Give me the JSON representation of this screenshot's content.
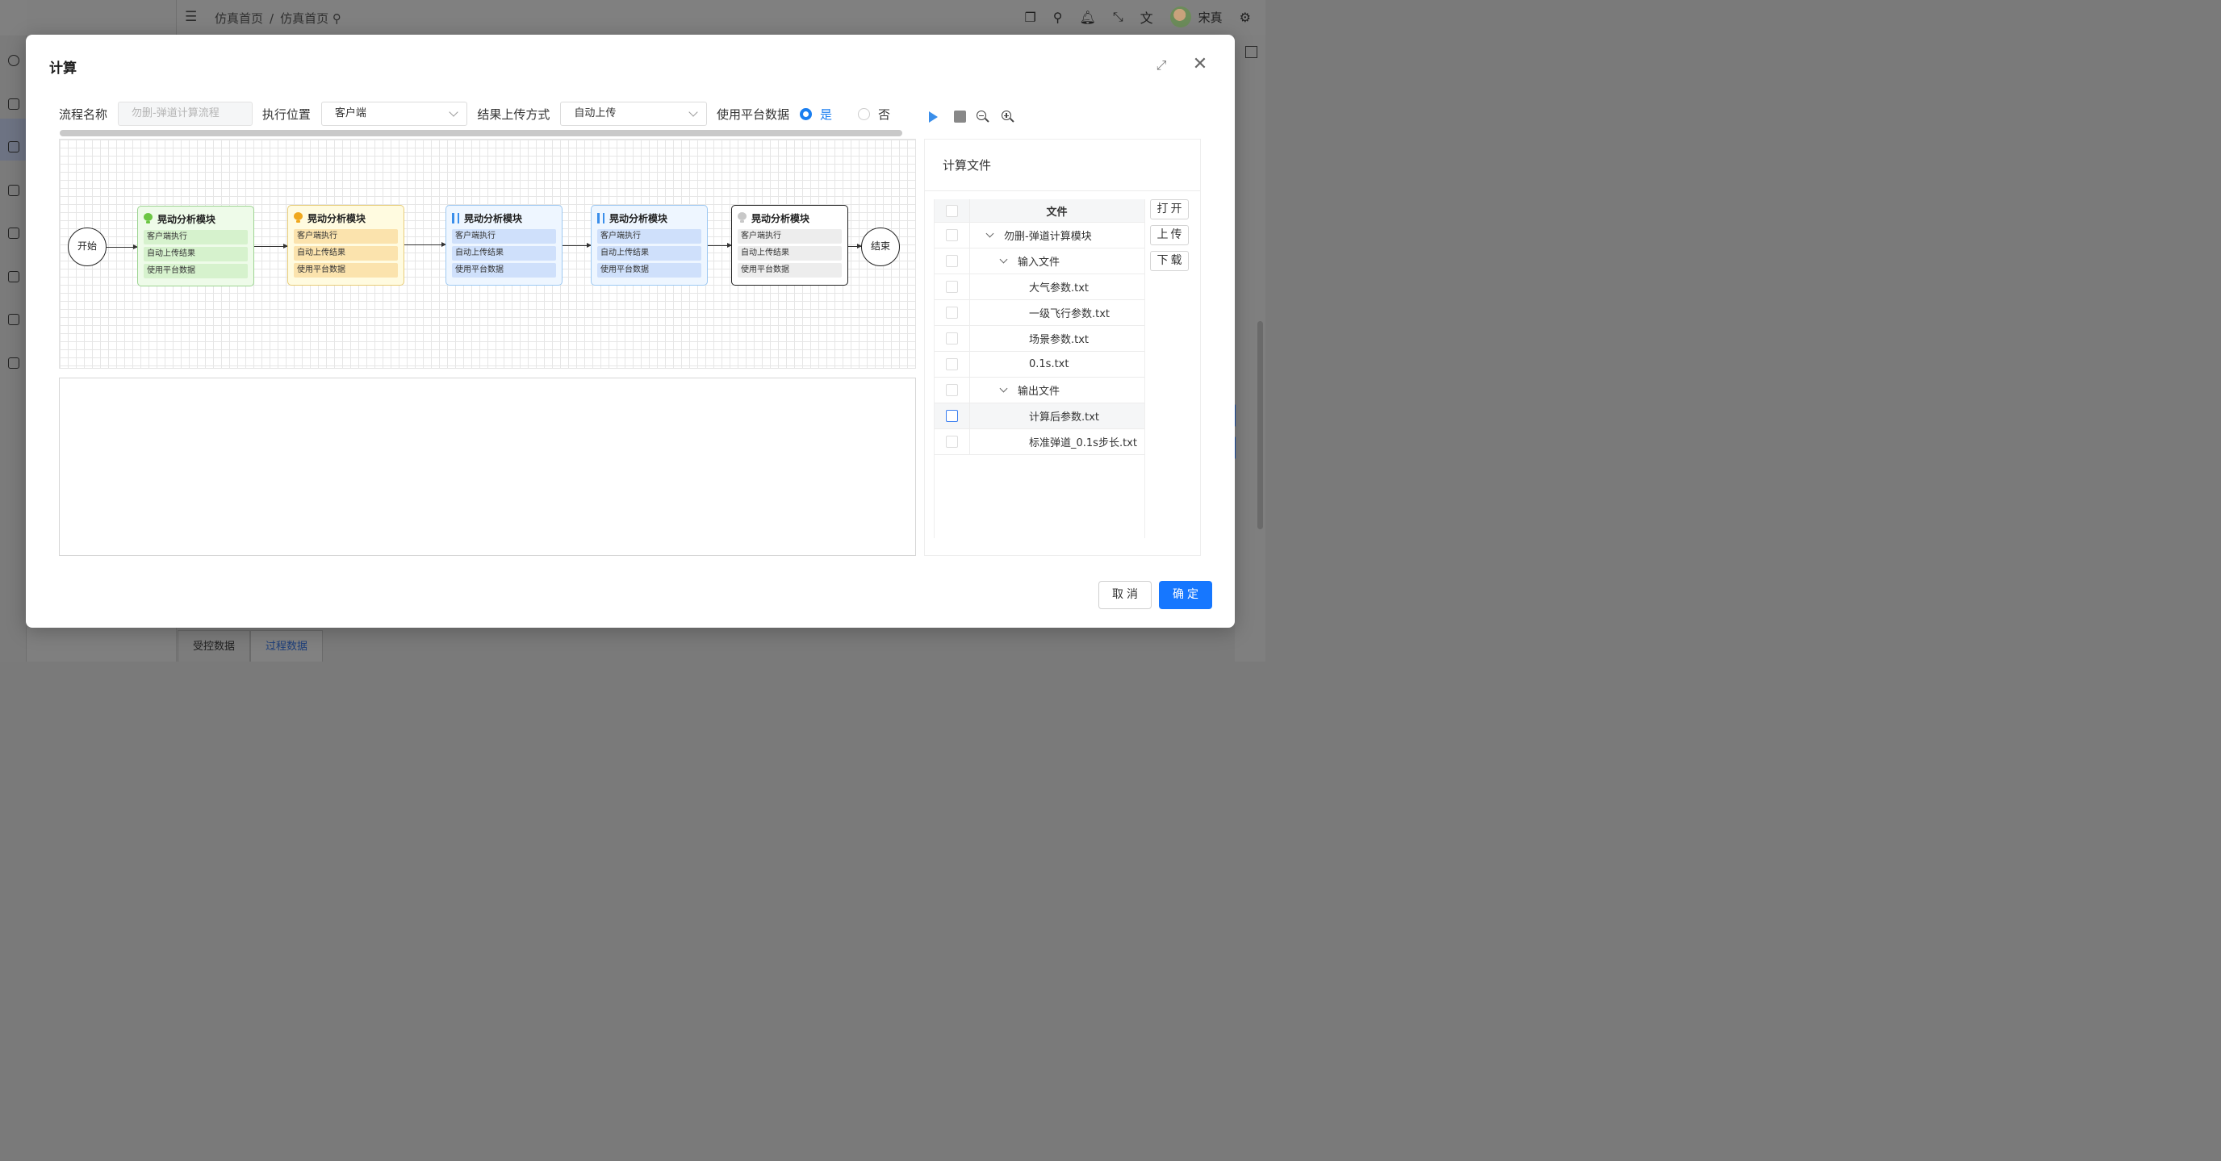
{
  "topbar": {
    "breadcrumb": [
      "仿真首页",
      "仿真首页"
    ],
    "user_name": "宋真",
    "icons": [
      "menu-fold-icon",
      "search-icon",
      "copy-icon",
      "bell-icon",
      "fullscreen-icon",
      "translate-icon",
      "settings-icon"
    ]
  },
  "bottom_tabs": [
    "受控数据",
    "过程数据"
  ],
  "modal": {
    "title": "计算",
    "form": {
      "process_name_label": "流程名称",
      "process_name_placeholder": "勿删-弹道计算流程",
      "exec_location_label": "执行位置",
      "exec_location_value": "客户端",
      "upload_mode_label": "结果上传方式",
      "upload_mode_value": "自动上传",
      "use_platform_label": "使用平台数据",
      "radio_yes": "是",
      "radio_no": "否",
      "selected": "是"
    },
    "flow": {
      "start_label": "开始",
      "end_label": "结束",
      "nodes": [
        {
          "title": "晃动分析模块",
          "status": "success",
          "color": "#6cc644",
          "rows": [
            "客户端执行",
            "自动上传结果",
            "使用平台数据"
          ]
        },
        {
          "title": "晃动分析模块",
          "status": "running",
          "color": "#f0a81e",
          "rows": [
            "客户端执行",
            "自动上传结果",
            "使用平台数据"
          ]
        },
        {
          "title": "晃动分析模块",
          "status": "paused",
          "color": "#3a8eea",
          "rows": [
            "客户端执行",
            "自动上传结果",
            "使用平台数据"
          ]
        },
        {
          "title": "晃动分析模块",
          "status": "paused",
          "color": "#3a8eea",
          "rows": [
            "客户端执行",
            "自动上传结果",
            "使用平台数据"
          ]
        },
        {
          "title": "晃动分析模块",
          "status": "idle",
          "color": "#c8c8c8",
          "rows": [
            "客户端执行",
            "自动上传结果",
            "使用平台数据"
          ]
        }
      ]
    },
    "file_panel": {
      "title": "计算文件",
      "column_header": "文件",
      "tree": [
        {
          "name": "勿删-弹道计算模块",
          "level": 0,
          "expandable": true
        },
        {
          "name": "输入文件",
          "level": 1,
          "expandable": true
        },
        {
          "name": "大气参数.txt",
          "level": 2,
          "expandable": false
        },
        {
          "name": "一级飞行参数.txt",
          "level": 2,
          "expandable": false
        },
        {
          "name": "场景参数.txt",
          "level": 2,
          "expandable": false
        },
        {
          "name": "0.1s.txt",
          "level": 2,
          "expandable": false
        },
        {
          "name": "输出文件",
          "level": 1,
          "expandable": true
        },
        {
          "name": "计算后参数.txt",
          "level": 2,
          "expandable": false
        },
        {
          "name": "标准弹道_0.1s步长.txt",
          "level": 2,
          "expandable": false
        }
      ],
      "buttons": {
        "open": "打开",
        "upload": "上传",
        "download": "下载"
      }
    },
    "footer": {
      "cancel": "取消",
      "confirm": "确定"
    },
    "accent_color": "#1677ff"
  }
}
